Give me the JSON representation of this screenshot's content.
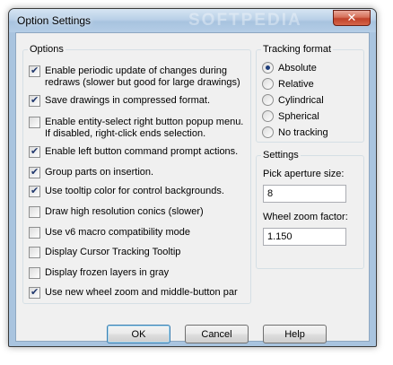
{
  "window": {
    "title": "Option Settings",
    "watermark": "SOFTPEDIA",
    "close_glyph": "✕"
  },
  "options": {
    "legend": "Options",
    "items": [
      {
        "label": "Enable periodic update of changes during redraws (slower but good for large drawings)",
        "checked": true
      },
      {
        "label": "Save drawings in compressed format.",
        "checked": true
      },
      {
        "label": "Enable entity-select right button popup menu. If disabled, right-click ends selection.",
        "checked": false
      },
      {
        "label": "Enable left button command prompt actions.",
        "checked": true
      },
      {
        "label": "Group parts on insertion.",
        "checked": true
      },
      {
        "label": "Use tooltip color for control backgrounds.",
        "checked": true
      },
      {
        "label": "Draw high resolution conics (slower)",
        "checked": false
      },
      {
        "label": "Use v6 macro compatibility mode",
        "checked": false
      },
      {
        "label": "Display Cursor Tracking Tooltip",
        "checked": false
      },
      {
        "label": "Display frozen layers in gray",
        "checked": false
      },
      {
        "label": "Use new wheel zoom and middle-button par",
        "checked": true
      }
    ]
  },
  "tracking": {
    "legend": "Tracking format",
    "items": [
      {
        "label": "Absolute",
        "selected": true
      },
      {
        "label": "Relative",
        "selected": false
      },
      {
        "label": "Cylindrical",
        "selected": false
      },
      {
        "label": "Spherical",
        "selected": false
      },
      {
        "label": "No tracking",
        "selected": false
      }
    ]
  },
  "settings": {
    "legend": "Settings",
    "aperture_label": "Pick aperture size:",
    "aperture_value": "8",
    "zoom_label": "Wheel zoom factor:",
    "zoom_value": "1.150"
  },
  "buttons": {
    "ok": "OK",
    "cancel": "Cancel",
    "help": "Help"
  },
  "colors": {
    "frame": "#a9c4df",
    "client": "#f0f0f0",
    "close": "#c0412a",
    "check": "#21386e"
  }
}
